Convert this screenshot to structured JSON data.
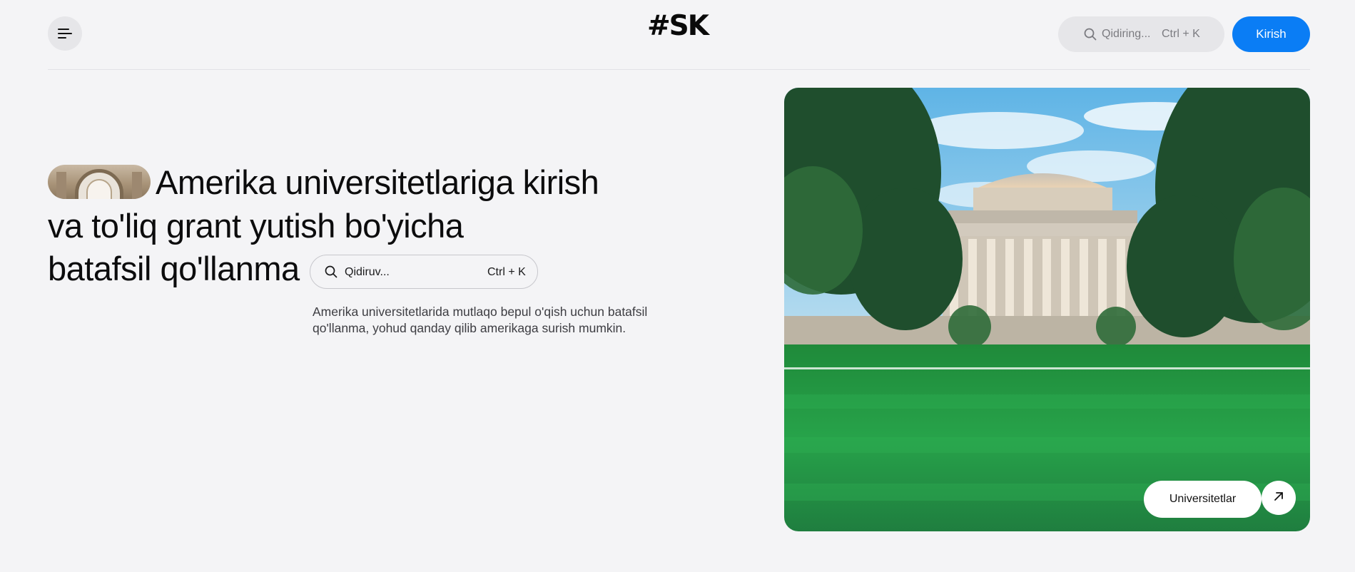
{
  "header": {
    "logo": "#SK",
    "search": {
      "placeholder": "Qidiring...",
      "shortcut": "Ctrl + K"
    },
    "login_label": "Kirish",
    "accent_color": "#0a7df5"
  },
  "hero": {
    "headline_line1": "Amerika universitetlariga kirish",
    "headline_line2": "va to'liq grant yutish bo'yicha",
    "headline_line3": "batafsil qo'llanma",
    "search": {
      "placeholder": "Qidiruv...",
      "shortcut": "Ctrl + K"
    },
    "description": "Amerika universitetlarida mutlaqo bepul o'qish uchun batafsil qo'llanma, yohud qanday qilib amerikaga surish mumkin.",
    "image_button_label": "Universitetlar"
  },
  "icons": {
    "menu": "menu-icon",
    "search": "search-icon",
    "arrow": "arrow-up-right-icon"
  }
}
